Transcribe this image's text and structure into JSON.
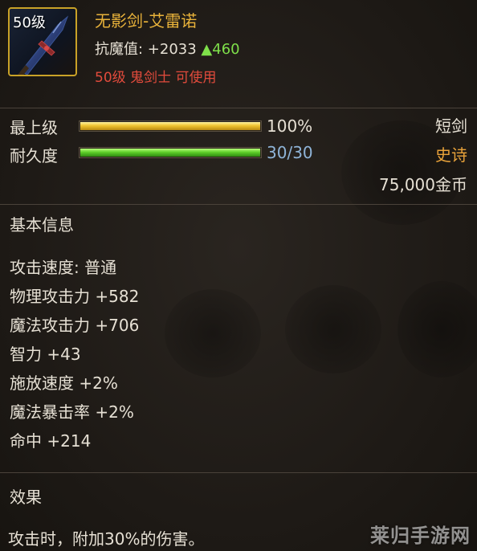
{
  "item": {
    "level_badge": "50级",
    "name": "无影剑-艾雷诺",
    "resist_label": "抗魔值: +2033",
    "resist_bonus": "▲460",
    "requirement": "50级 鬼剑士 可使用"
  },
  "bars": [
    {
      "label": "最上级",
      "value_text": "100%",
      "fill": 1.0,
      "color": "#f0c330"
    },
    {
      "label": "耐久度",
      "value_text": "30/30",
      "fill": 1.0,
      "color": "#5fcf2a"
    }
  ],
  "info_right": {
    "type": "短剑",
    "rarity": "史诗",
    "price": "75,000金币"
  },
  "colors": {
    "gold": "#e8b23a",
    "requirement_red": "#e24b3c",
    "bonus_green": "#7fe04a",
    "durability_blue": "#8fb4d8",
    "rarity_orange": "#e8a23a"
  },
  "basic_info": {
    "title": "基本信息",
    "stats": [
      "攻击速度: 普通",
      "物理攻击力 +582",
      "魔法攻击力 +706",
      "智力 +43",
      "施放速度 +2%",
      "魔法暴击率 +2%",
      "命中 +214"
    ]
  },
  "effect": {
    "title": "效果",
    "text": "攻击时，附加30%的伤害。"
  },
  "watermark": "莱归手游网",
  "icons": {
    "item": "dagger-icon"
  }
}
